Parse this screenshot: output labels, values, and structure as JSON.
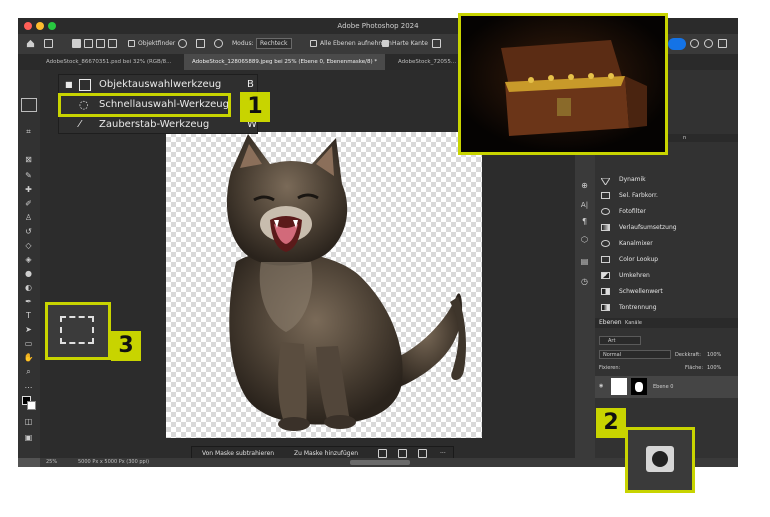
{
  "window": {
    "title": "Adobe Photoshop 2024"
  },
  "options_bar": {
    "object_finder": "Objektfinder",
    "mode_label": "Modus:",
    "mode_value": "Rechteck",
    "all_layers": "Alle Ebenen aufnehmen",
    "hard_edge": "Harte Kante"
  },
  "tabs": [
    {
      "label": "AdobeStock_86670351.psd bei 32% (RGB/8..."
    },
    {
      "label": "AdobeStock_128065889.jpeg bei 25% (Ebene 0, Ebenenmaske/8) *"
    },
    {
      "label": "AdobeStock_72055..."
    }
  ],
  "tool_popup": {
    "items": [
      {
        "label": "Objektauswahlwerkzeug",
        "shortcut": "B"
      },
      {
        "label": "Schnellauswahl-Werkzeug",
        "shortcut": "W"
      },
      {
        "label": "Zauberstab-Werkzeug",
        "shortcut": "W"
      }
    ]
  },
  "callouts": {
    "one": "1",
    "two": "2",
    "three": "3"
  },
  "mask_bar": {
    "subtract": "Von Maske subtrahieren",
    "add": "Zu Maske hinzufügen",
    "more": "···"
  },
  "status_bar": {
    "zoom": "25%",
    "doc_size": "5000 Px x 5000 Px (300 ppi)"
  },
  "adjustments_panel": {
    "header_fragment": "n",
    "items": [
      {
        "label": "Dynamik"
      },
      {
        "label": "Sel. Farbkorr."
      },
      {
        "label": "Fotofilter"
      },
      {
        "label": "Verlaufsumsetzung"
      },
      {
        "label": "Kanalmixer"
      },
      {
        "label": "Color Lookup"
      },
      {
        "label": "Umkehren"
      },
      {
        "label": "Schwellenwert"
      },
      {
        "label": "Tontrennung"
      }
    ]
  },
  "layers_panel": {
    "tabs": [
      "Ebenen",
      "Kanäle"
    ],
    "filter": "Art",
    "blend_mode": "Normal",
    "opacity_label": "Deckkraft:",
    "opacity_value": "100%",
    "lock_label": "Fixieren:",
    "fill_label": "Fläche:",
    "fill_value": "100%",
    "layer_name": "Ebene 0"
  },
  "colors": {
    "accent": "#c8d400",
    "panel_bg": "#323232",
    "canvas_bg": "#2c2c2c"
  }
}
